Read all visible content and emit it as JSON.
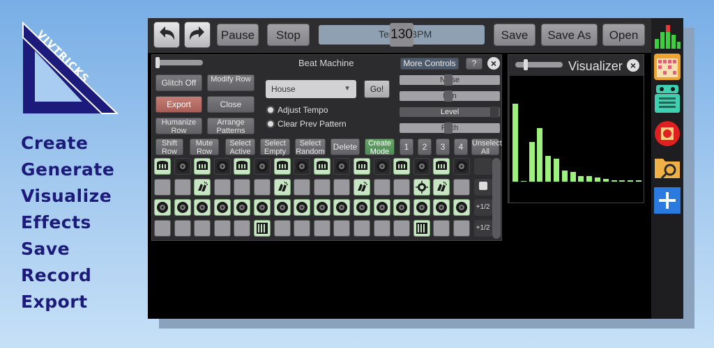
{
  "brand": {
    "logo_text": "VIVTRICKS",
    "accent": "#1c1a7a"
  },
  "features": [
    "Create",
    "Generate",
    "Visualize",
    "Effects",
    "Save",
    "Record",
    "Export"
  ],
  "topbar": {
    "undo_icon": "undo-arrow-icon",
    "redo_icon": "redo-arrow-icon",
    "pause": "Pause",
    "stop": "Stop",
    "tempo_label": "Tempo BPM",
    "tempo_value": "130",
    "save": "Save",
    "save_as": "Save As",
    "open": "Open"
  },
  "beat_machine": {
    "title": "Beat Machine",
    "more_controls": "More Controls",
    "help": "?",
    "close": "×",
    "buttons": {
      "glitch_off": "Glitch Off",
      "modify_row": "Modify Row",
      "export": "Export",
      "close": "Close",
      "humanize_row": "Humanize Row",
      "arrange_patterns": "Arrange Patterns",
      "go": "Go!"
    },
    "genre_select": "House",
    "adjust_tempo": "Adjust Tempo",
    "clear_prev_pattern": "Clear Prev Pattern",
    "sliders": [
      "Noise",
      "Pan",
      "Level",
      "Pitch"
    ],
    "actions": [
      "Shift Row",
      "Mute Row",
      "Select Active",
      "Select Empty",
      "Select Random",
      "Delete",
      "Create Mode",
      "1",
      "2",
      "3",
      "4",
      "Unselect All"
    ],
    "row_buttons": [
      "",
      "",
      "+1/2",
      "+1/2"
    ],
    "rows": [
      [
        "drum",
        "vinyl",
        "drum",
        "vinyl",
        "drum",
        "vinyl",
        "drum",
        "vinyl",
        "drum",
        "vinyl",
        "drum",
        "vinyl",
        "drum",
        "vinyl",
        "drum",
        "vinyl"
      ],
      [
        "off",
        "off",
        "clap",
        "off",
        "off",
        "off",
        "clap",
        "off",
        "off",
        "off",
        "clap",
        "off",
        "off",
        "tom",
        "clap",
        "off"
      ],
      [
        "vinyl",
        "vinyl",
        "vinyl",
        "vinyl",
        "vinyl",
        "vinyl",
        "vinyl",
        "vinyl",
        "vinyl",
        "vinyl",
        "vinyl",
        "vinyl",
        "vinyl",
        "vinyl",
        "vinyl",
        "vinyl"
      ],
      [
        "off",
        "off",
        "off",
        "off",
        "off",
        "piano",
        "off",
        "off",
        "off",
        "off",
        "off",
        "off",
        "off",
        "piano",
        "off",
        "off"
      ]
    ]
  },
  "visualizer": {
    "title": "Visualizer",
    "close": "×",
    "levels": [
      0.55,
      0,
      0.28,
      0.38,
      0.18,
      0.16,
      0.08,
      0.07,
      0.04,
      0.04,
      0.03,
      0.02,
      0.01,
      0.01,
      0.01,
      0.01
    ],
    "bar_color": "#9cf07c"
  },
  "side_apps": [
    "equalizer-app-icon",
    "drum-pad-app-icon",
    "robot-app-icon",
    "record-app-icon",
    "folder-search-app-icon",
    "add-app-icon"
  ]
}
